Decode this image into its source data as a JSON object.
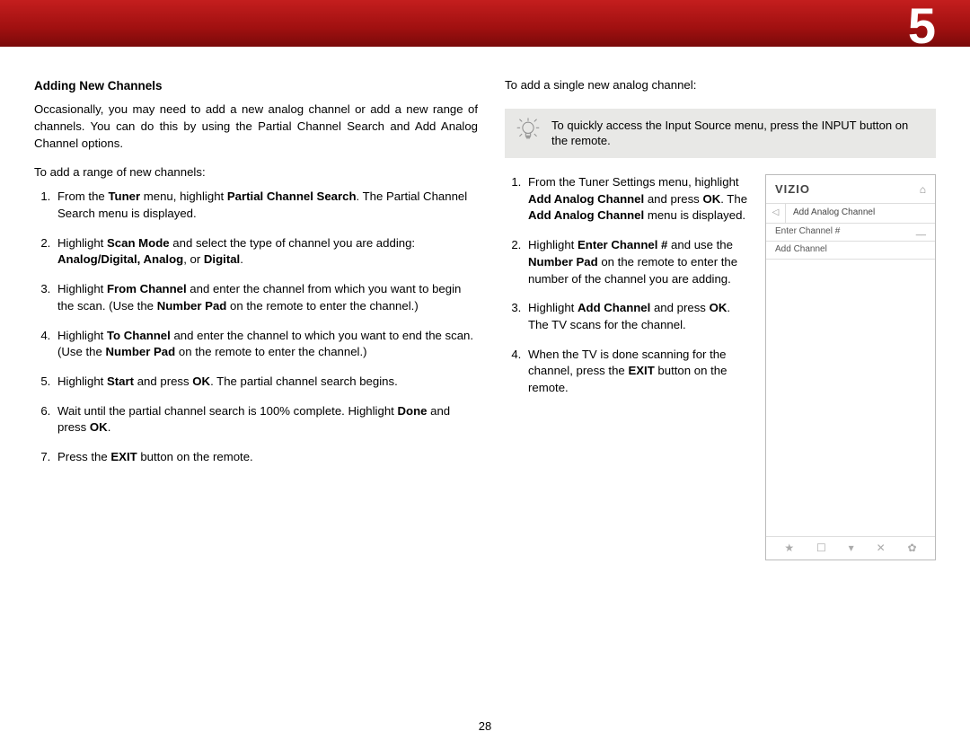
{
  "chapter_number": "5",
  "page_number": "28",
  "left": {
    "heading": "Adding New Channels",
    "intro": "Occasionally, you may need to add a new analog channel or add a new range of channels. You can do this by using the Partial Channel Search and Add Analog Channel options.",
    "lead": "To add a range of new channels:",
    "s1_a": "From the ",
    "s1_b": "Tuner",
    "s1_c": " menu, highlight ",
    "s1_d": "Partial Channel Search",
    "s1_e": ". The Partial Channel Search menu is displayed.",
    "s2_a": "Highlight ",
    "s2_b": "Scan Mode",
    "s2_c": " and select the type of channel you are adding: ",
    "s2_d": "Analog/Digital, Analog",
    "s2_e": ", or ",
    "s2_f": "Digital",
    "s2_g": ".",
    "s3_a": "Highlight ",
    "s3_b": "From Channel",
    "s3_c": " and enter the channel from which you want to begin the scan. (Use the ",
    "s3_d": "Number Pad",
    "s3_e": " on the remote to enter the channel.)",
    "s4_a": "Highlight ",
    "s4_b": "To Channel",
    "s4_c": " and enter the channel to which you want to end the scan. (Use the ",
    "s4_d": "Number Pad",
    "s4_e": " on the remote to enter the channel.)",
    "s5_a": "Highlight ",
    "s5_b": "Start",
    "s5_c": " and press ",
    "s5_d": "OK",
    "s5_e": ". The partial channel search begins.",
    "s6_a": "Wait until the partial channel search is 100% complete. Highlight ",
    "s6_b": "Done",
    "s6_c": " and press ",
    "s6_d": "OK",
    "s6_e": ".",
    "s7_a": "Press the ",
    "s7_b": "EXIT",
    "s7_c": " button on the remote."
  },
  "right": {
    "lead": "To add a single new analog channel:",
    "tip": "To quickly access the Input Source menu, press the INPUT button on the remote.",
    "s1_a": "From the Tuner Settings menu, highlight ",
    "s1_b": "Add Analog Channel",
    "s1_c": " and press ",
    "s1_d": "OK",
    "s1_e": ". The ",
    "s1_f": "Add Analog Channel",
    "s1_g": " menu is displayed.",
    "s2_a": "Highlight ",
    "s2_b": "Enter Channel #",
    "s2_c": " and use the ",
    "s2_d": "Number Pad",
    "s2_e": " on the remote to enter the number of the channel you are adding.",
    "s3_a": "Highlight ",
    "s3_b": "Add Channel",
    "s3_c": " and press ",
    "s3_d": "OK",
    "s3_e": ". The TV scans for the channel.",
    "s4_a": "When the TV is done scanning for the channel, press the ",
    "s4_b": "EXIT",
    "s4_c": " button on the remote."
  },
  "menu": {
    "brand": "VIZIO",
    "title": "Add Analog Channel",
    "row1_label": "Enter Channel #",
    "row1_value": "__",
    "row2_label": "Add Channel",
    "footer_star": "★",
    "footer_cc": "☐",
    "footer_v": "▾",
    "footer_x": "✕",
    "footer_gear": "✿"
  }
}
